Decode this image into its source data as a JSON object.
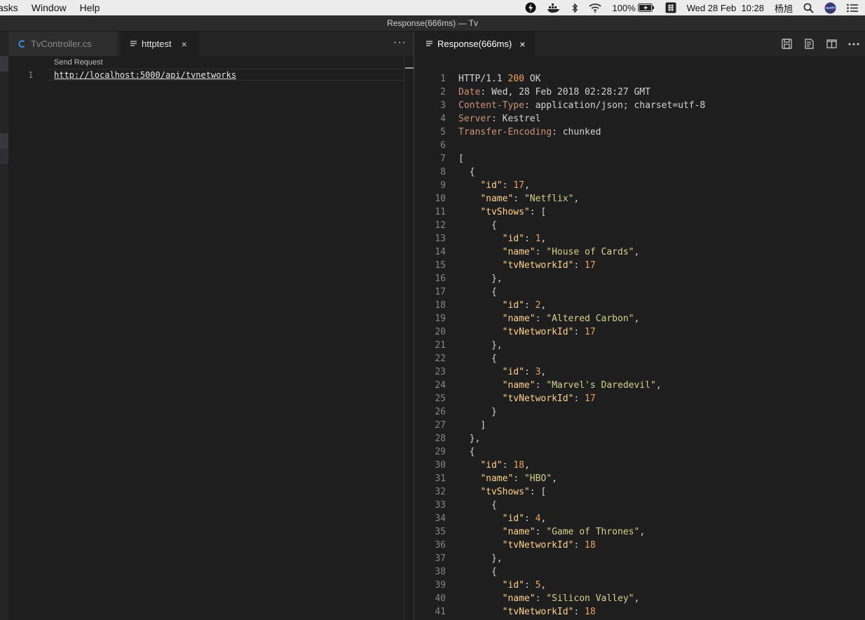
{
  "menubar": {
    "menus": [
      "asks",
      "Window",
      "Help"
    ],
    "battery": "100%",
    "datetime": "Wed 28 Feb  10:28",
    "user": "杨旭"
  },
  "window": {
    "title": "Response(666ms) — Tv"
  },
  "left_editor": {
    "tabs": [
      {
        "label": "TvController.cs",
        "icon": "csharp-icon",
        "active": false
      },
      {
        "label": "httptest",
        "icon": "document-lines-icon",
        "active": true,
        "close": "×"
      }
    ],
    "more": "···",
    "codelens": "Send Request",
    "line_number": "1",
    "url": "http://localhost:5000/api/tvnetworks"
  },
  "right_editor": {
    "tab": {
      "label": "Response(666ms)",
      "icon": "document-lines-icon",
      "close": "×"
    },
    "actions": [
      "save-icon",
      "preview-icon",
      "split-editor-icon",
      "more-icon"
    ],
    "lines": [
      [
        [
          "HTTP/1.1 ",
          "hv"
        ],
        [
          "200",
          "num"
        ],
        [
          " OK",
          "hv"
        ]
      ],
      [
        [
          "Date",
          "hdr"
        ],
        [
          ": Wed, 28 Feb 2018 02:28:27 GMT",
          "hv"
        ]
      ],
      [
        [
          "Content-Type",
          "hdr"
        ],
        [
          ": application/json; charset=utf-8",
          "hv"
        ]
      ],
      [
        [
          "Server",
          "hdr"
        ],
        [
          ": Kestrel",
          "hv"
        ]
      ],
      [
        [
          "Transfer-Encoding",
          "hdr"
        ],
        [
          ": chunked",
          "hv"
        ]
      ],
      [],
      [
        [
          "[",
          "pun"
        ]
      ],
      [
        [
          "  {",
          "pun"
        ]
      ],
      [
        [
          "    ",
          "pun"
        ],
        [
          "\"id\"",
          "key"
        ],
        [
          ": ",
          "pun"
        ],
        [
          "17",
          "num"
        ],
        [
          ",",
          "pun"
        ]
      ],
      [
        [
          "    ",
          "pun"
        ],
        [
          "\"name\"",
          "key"
        ],
        [
          ": ",
          "pun"
        ],
        [
          "\"Netflix\"",
          "str"
        ],
        [
          ",",
          "pun"
        ]
      ],
      [
        [
          "    ",
          "pun"
        ],
        [
          "\"tvShows\"",
          "key"
        ],
        [
          ": [",
          "pun"
        ]
      ],
      [
        [
          "      {",
          "pun"
        ]
      ],
      [
        [
          "        ",
          "pun"
        ],
        [
          "\"id\"",
          "key"
        ],
        [
          ": ",
          "pun"
        ],
        [
          "1",
          "num"
        ],
        [
          ",",
          "pun"
        ]
      ],
      [
        [
          "        ",
          "pun"
        ],
        [
          "\"name\"",
          "key"
        ],
        [
          ": ",
          "pun"
        ],
        [
          "\"House of Cards\"",
          "str"
        ],
        [
          ",",
          "pun"
        ]
      ],
      [
        [
          "        ",
          "pun"
        ],
        [
          "\"tvNetworkId\"",
          "key"
        ],
        [
          ": ",
          "pun"
        ],
        [
          "17",
          "num"
        ]
      ],
      [
        [
          "      },",
          "pun"
        ]
      ],
      [
        [
          "      {",
          "pun"
        ]
      ],
      [
        [
          "        ",
          "pun"
        ],
        [
          "\"id\"",
          "key"
        ],
        [
          ": ",
          "pun"
        ],
        [
          "2",
          "num"
        ],
        [
          ",",
          "pun"
        ]
      ],
      [
        [
          "        ",
          "pun"
        ],
        [
          "\"name\"",
          "key"
        ],
        [
          ": ",
          "pun"
        ],
        [
          "\"Altered Carbon\"",
          "str"
        ],
        [
          ",",
          "pun"
        ]
      ],
      [
        [
          "        ",
          "pun"
        ],
        [
          "\"tvNetworkId\"",
          "key"
        ],
        [
          ": ",
          "pun"
        ],
        [
          "17",
          "num"
        ]
      ],
      [
        [
          "      },",
          "pun"
        ]
      ],
      [
        [
          "      {",
          "pun"
        ]
      ],
      [
        [
          "        ",
          "pun"
        ],
        [
          "\"id\"",
          "key"
        ],
        [
          ": ",
          "pun"
        ],
        [
          "3",
          "num"
        ],
        [
          ",",
          "pun"
        ]
      ],
      [
        [
          "        ",
          "pun"
        ],
        [
          "\"name\"",
          "key"
        ],
        [
          ": ",
          "pun"
        ],
        [
          "\"Marvel's Daredevil\"",
          "str"
        ],
        [
          ",",
          "pun"
        ]
      ],
      [
        [
          "        ",
          "pun"
        ],
        [
          "\"tvNetworkId\"",
          "key"
        ],
        [
          ": ",
          "pun"
        ],
        [
          "17",
          "num"
        ]
      ],
      [
        [
          "      }",
          "pun"
        ]
      ],
      [
        [
          "    ]",
          "pun"
        ]
      ],
      [
        [
          "  },",
          "pun"
        ]
      ],
      [
        [
          "  {",
          "pun"
        ]
      ],
      [
        [
          "    ",
          "pun"
        ],
        [
          "\"id\"",
          "key"
        ],
        [
          ": ",
          "pun"
        ],
        [
          "18",
          "num"
        ],
        [
          ",",
          "pun"
        ]
      ],
      [
        [
          "    ",
          "pun"
        ],
        [
          "\"name\"",
          "key"
        ],
        [
          ": ",
          "pun"
        ],
        [
          "\"HBO\"",
          "str"
        ],
        [
          ",",
          "pun"
        ]
      ],
      [
        [
          "    ",
          "pun"
        ],
        [
          "\"tvShows\"",
          "key"
        ],
        [
          ": [",
          "pun"
        ]
      ],
      [
        [
          "      {",
          "pun"
        ]
      ],
      [
        [
          "        ",
          "pun"
        ],
        [
          "\"id\"",
          "key"
        ],
        [
          ": ",
          "pun"
        ],
        [
          "4",
          "num"
        ],
        [
          ",",
          "pun"
        ]
      ],
      [
        [
          "        ",
          "pun"
        ],
        [
          "\"name\"",
          "key"
        ],
        [
          ": ",
          "pun"
        ],
        [
          "\"Game of Thrones\"",
          "str"
        ],
        [
          ",",
          "pun"
        ]
      ],
      [
        [
          "        ",
          "pun"
        ],
        [
          "\"tvNetworkId\"",
          "key"
        ],
        [
          ": ",
          "pun"
        ],
        [
          "18",
          "num"
        ]
      ],
      [
        [
          "      },",
          "pun"
        ]
      ],
      [
        [
          "      {",
          "pun"
        ]
      ],
      [
        [
          "        ",
          "pun"
        ],
        [
          "\"id\"",
          "key"
        ],
        [
          ": ",
          "pun"
        ],
        [
          "5",
          "num"
        ],
        [
          ",",
          "pun"
        ]
      ],
      [
        [
          "        ",
          "pun"
        ],
        [
          "\"name\"",
          "key"
        ],
        [
          ": ",
          "pun"
        ],
        [
          "\"Silicon Valley\"",
          "str"
        ],
        [
          ",",
          "pun"
        ]
      ],
      [
        [
          "        ",
          "pun"
        ],
        [
          "\"tvNetworkId\"",
          "key"
        ],
        [
          ": ",
          "pun"
        ],
        [
          "18",
          "num"
        ]
      ]
    ]
  }
}
